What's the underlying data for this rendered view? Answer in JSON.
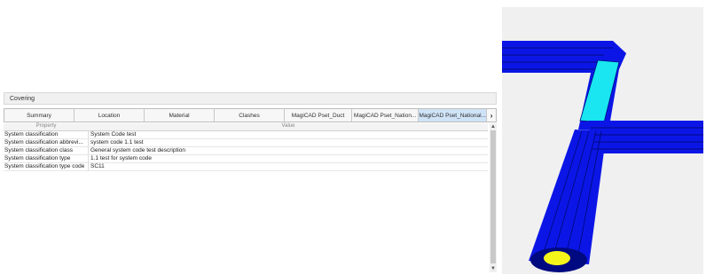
{
  "panel": {
    "title": "Covering"
  },
  "tabs": [
    {
      "label": "Summary"
    },
    {
      "label": "Location"
    },
    {
      "label": "Material"
    },
    {
      "label": "Clashes"
    },
    {
      "label": "MagiCAD Pset_Duct"
    },
    {
      "label": "MagiCAD Pset_Nation..."
    },
    {
      "label": "MagiCAD Pset_National..."
    }
  ],
  "tab_scroll_glyph": "›",
  "grid": {
    "header_property": "Property",
    "header_value": "Value",
    "rows": [
      {
        "property": "System classification",
        "value": "System Code test"
      },
      {
        "property": "System classification abbrevi...",
        "value": "system code 1.1 test"
      },
      {
        "property": "System classification class",
        "value": "General system code test description"
      },
      {
        "property": "System classification type",
        "value": "1.1 test for system code"
      },
      {
        "property": "System classification type code",
        "value": "SC11"
      }
    ]
  },
  "scrollbar": {
    "up_glyph": "▲",
    "down_glyph": "▼"
  },
  "viewport_colors": {
    "background": "#f0f0f0",
    "duct": "#0b16e6",
    "duct_lines": "#000a80",
    "covering": "#19e6f0",
    "end_cap": "#f5f51a"
  }
}
